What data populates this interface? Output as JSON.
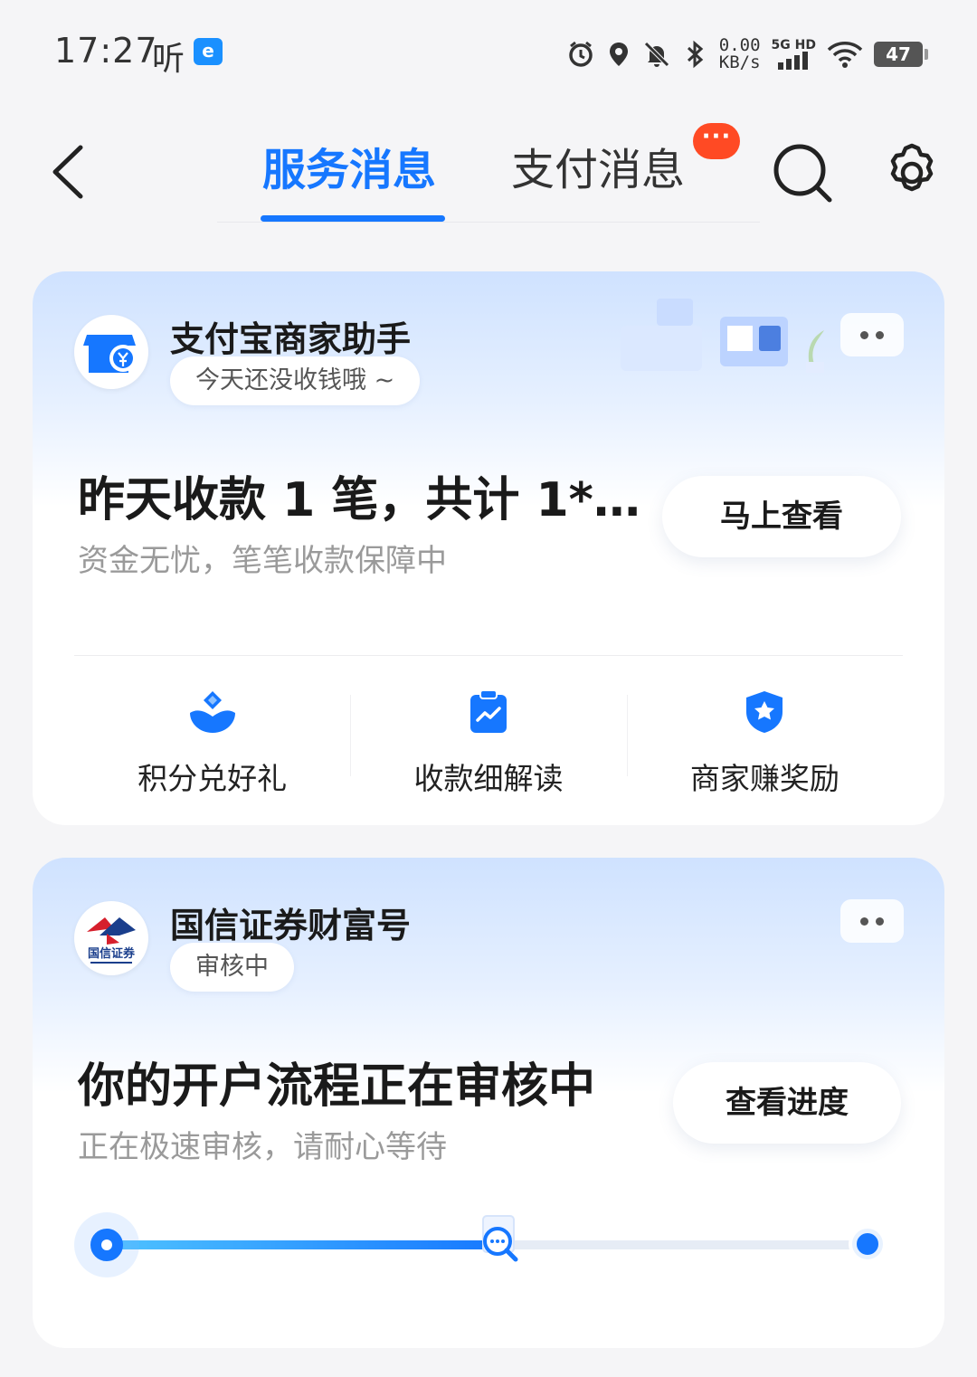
{
  "status_bar": {
    "time": "17:27",
    "listen_label": "听",
    "app_icon_letter": "e",
    "net_speed_value": "0.00",
    "net_speed_unit": "KB/s",
    "network_label": "5G HD",
    "battery": "47"
  },
  "header": {
    "tabs": [
      {
        "label": "服务消息",
        "active": true
      },
      {
        "label": "支付消息",
        "active": false,
        "badge": "···"
      }
    ]
  },
  "cards": [
    {
      "title": "支付宝商家助手",
      "tag": "今天还没收钱哦 ~",
      "headline": "昨天收款 1 笔，共计 1*…",
      "subline": "资金无忧，笔笔收款保障中",
      "button": "马上查看",
      "shortcuts": [
        {
          "label": "积分兑好礼",
          "icon": "gift-icon"
        },
        {
          "label": "收款细解读",
          "icon": "chart-clipboard-icon"
        },
        {
          "label": "商家赚奖励",
          "icon": "star-shield-icon"
        }
      ]
    },
    {
      "title": "国信证券财富号",
      "tag": "审核中",
      "headline": "你的开户流程正在审核中",
      "subline": "正在极速审核，请耐心等待",
      "button": "查看进度",
      "progress_fraction": 0.52
    }
  ],
  "colors": {
    "accent": "#1677ff",
    "badge": "#ff4a24",
    "background": "#f5f5f7"
  }
}
